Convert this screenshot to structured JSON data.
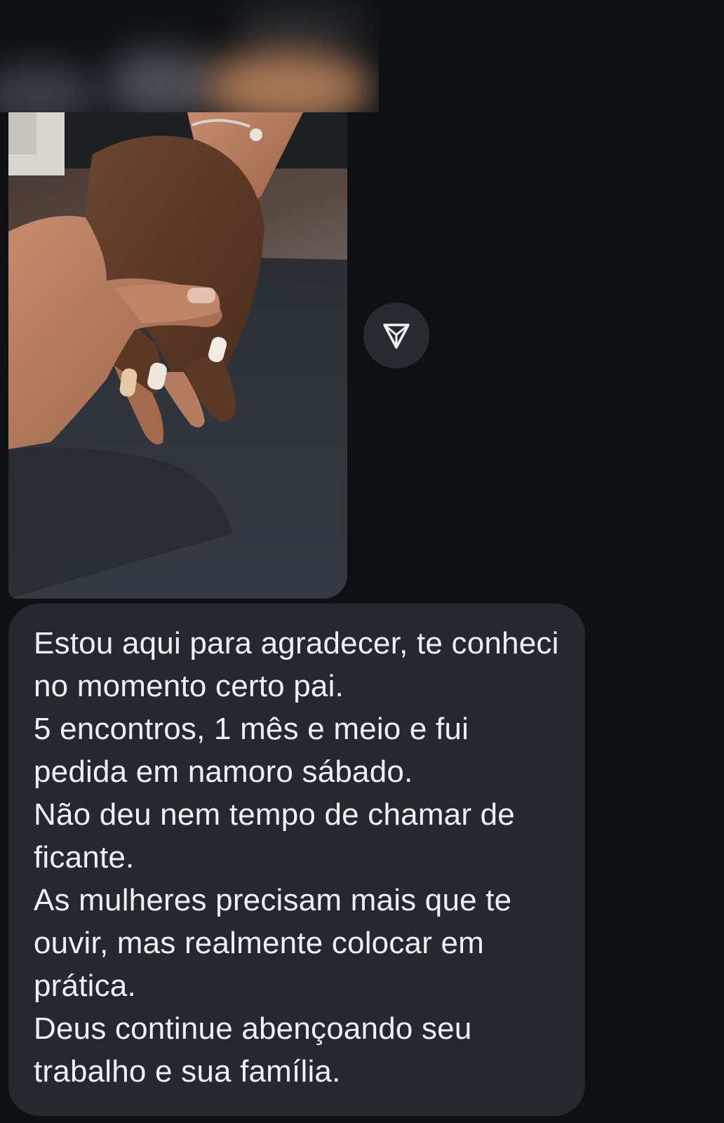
{
  "conversation": {
    "shared_photo": {
      "description_icon": "photo-hands-icon"
    },
    "share_button": {
      "icon": "paper-plane-icon"
    },
    "message": {
      "paragraphs": [
        "Estou aqui para agradecer, te conheci no momento certo pai.",
        "5 encontros, 1 mês e meio e fui pedida em namoro sábado.",
        "Não deu nem tempo de chamar de ficante.",
        "As mulheres precisam mais que te ouvir, mas realmente colocar em prática.",
        "Deus continue abençoando seu trabalho e sua família."
      ]
    }
  },
  "colors": {
    "background": "#0e1014",
    "bubble": "#25282f",
    "text": "#eef0f3",
    "button": "#262a31"
  }
}
